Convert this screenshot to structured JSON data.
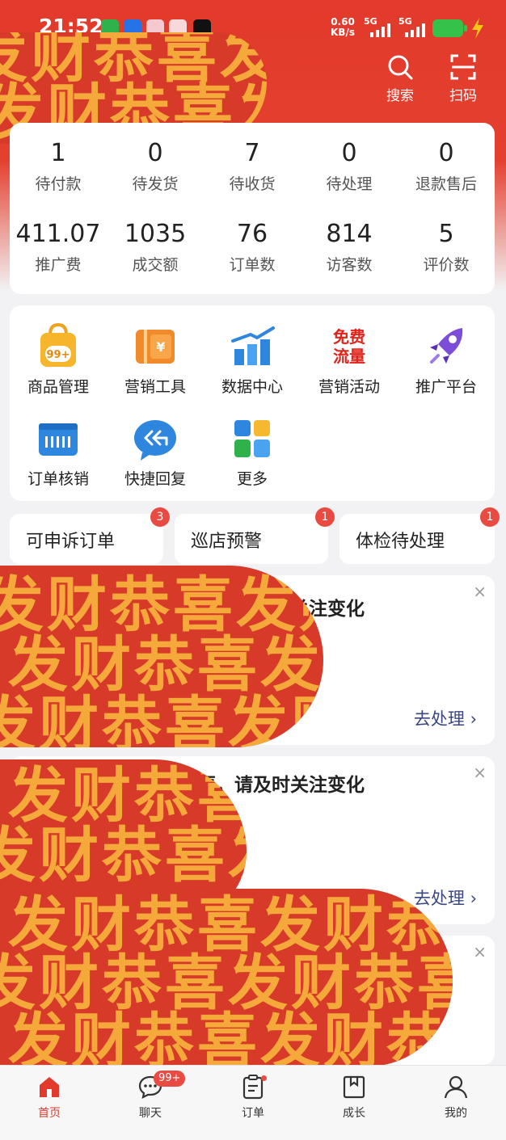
{
  "status_bar": {
    "time": "21:52",
    "net_speed_value": "0.60",
    "net_speed_unit": "KB/s",
    "signal_1": "5G",
    "signal_2": "5G",
    "notification_icons": [
      "wechat-icon",
      "alipay-icon",
      "app-icon-1",
      "app-icon-2",
      "tiktok-icon"
    ]
  },
  "header": {
    "search_label": "搜索",
    "scan_label": "扫码"
  },
  "order_stats": [
    {
      "value": "1",
      "label": "待付款"
    },
    {
      "value": "0",
      "label": "待发货"
    },
    {
      "value": "7",
      "label": "待收货"
    },
    {
      "value": "0",
      "label": "待处理"
    },
    {
      "value": "0",
      "label": "退款售后"
    }
  ],
  "business_stats": [
    {
      "value": "411.07",
      "label": "推广费"
    },
    {
      "value": "1035",
      "label": "成交额"
    },
    {
      "value": "76",
      "label": "订单数"
    },
    {
      "value": "814",
      "label": "访客数"
    },
    {
      "value": "5",
      "label": "评价数"
    }
  ],
  "tools": [
    {
      "label": "商品管理",
      "icon": "product-bag-icon",
      "badge": "99+"
    },
    {
      "label": "营销工具",
      "icon": "coupon-icon"
    },
    {
      "label": "数据中心",
      "icon": "bar-chart-icon"
    },
    {
      "label": "营销活动",
      "icon": "free-traffic-icon",
      "icon_text": [
        "免费",
        "流量"
      ]
    },
    {
      "label": "推广平台",
      "icon": "rocket-icon"
    },
    {
      "label": "订单核销",
      "icon": "order-verify-icon"
    },
    {
      "label": "快捷回复",
      "icon": "quick-reply-icon"
    },
    {
      "label": "更多",
      "icon": "more-grid-icon"
    }
  ],
  "alert_chips": [
    {
      "label": "可申诉订单",
      "badge": "3"
    },
    {
      "label": "巡店预警",
      "badge": "1"
    },
    {
      "label": "体检待处理",
      "badge": "1"
    }
  ],
  "notices": [
    {
      "title": "请及时关注变化",
      "action": "去处理",
      "close": "×"
    },
    {
      "title": "更，请及时关注变化",
      "action": "去处理",
      "close": "×"
    },
    {
      "title": "",
      "action": "",
      "close": "×"
    }
  ],
  "overlay_text": "发财恭喜",
  "tab_bar": [
    {
      "label": "首页",
      "icon": "home-icon",
      "active": true
    },
    {
      "label": "聊天",
      "icon": "chat-icon",
      "badge": "99+"
    },
    {
      "label": "订单",
      "icon": "order-icon",
      "dot": true
    },
    {
      "label": "成长",
      "icon": "growth-icon"
    },
    {
      "label": "我的",
      "icon": "profile-icon"
    }
  ],
  "colors": {
    "brand_red": "#e23a2c",
    "badge_red": "#e94a42",
    "link_blue": "#3a4780",
    "overlay_gold": "#f4a93a",
    "battery_green": "#35c24a"
  }
}
